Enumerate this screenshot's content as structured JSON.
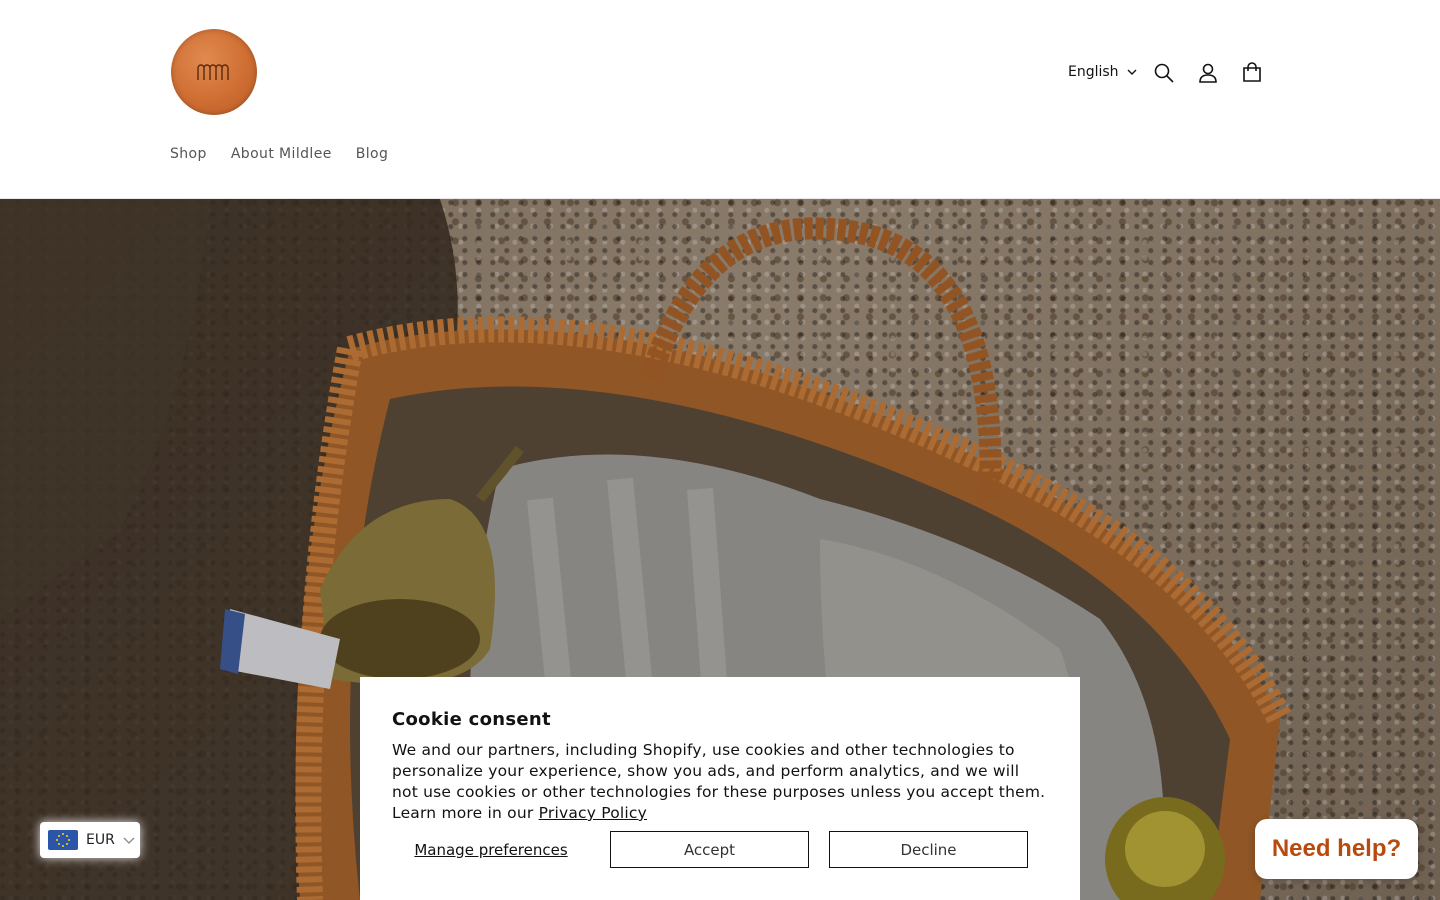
{
  "header": {
    "logo_alt": "Mildlee",
    "language": {
      "selected": "English"
    },
    "icons": [
      "search-icon",
      "account-icon",
      "cart-icon"
    ],
    "nav": [
      {
        "label": "Shop"
      },
      {
        "label": "About Mildlee"
      },
      {
        "label": "Blog"
      }
    ]
  },
  "currency": {
    "code": "EUR",
    "flag": "eu-flag-icon"
  },
  "cookie": {
    "title": "Cookie consent",
    "body": "We and our partners, including Shopify, use cookies and other technologies to personalize your experience, show you ads, and perform analytics, and we will not use cookies or other technologies for these purposes unless you accept them. Learn more in our ",
    "privacy_link": "Privacy Policy",
    "manage_label": "Manage preferences",
    "accept_label": "Accept",
    "decline_label": "Decline"
  },
  "help": {
    "label": "Need help?"
  },
  "colors": {
    "brand": "#cf6e33",
    "help_text": "#b84a0e"
  }
}
